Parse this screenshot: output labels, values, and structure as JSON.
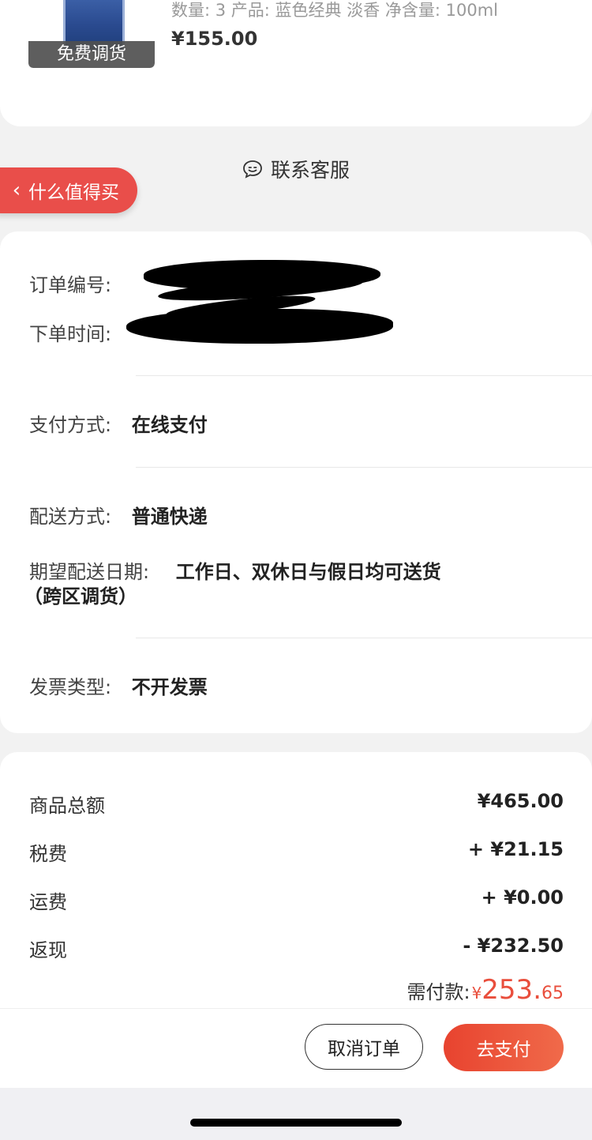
{
  "product": {
    "spec": "数量: 3  产品: 蓝色经典 淡香  净含量: 100ml",
    "price": "¥155.00",
    "badge": "免费调货"
  },
  "contact": {
    "label": "联系客服"
  },
  "floating": {
    "label": "什么值得买"
  },
  "order": {
    "number_label": "订单编号:",
    "time_label": "下单时间:",
    "payment_label": "支付方式:",
    "payment_value": "在线支付",
    "delivery_label": "配送方式:",
    "delivery_value": "普通快递",
    "expected_label": "期望配送日期:",
    "expected_value": "工作日、双休日与假日均可送货",
    "expected_note": "（跨区调货）",
    "invoice_label": "发票类型:",
    "invoice_value": "不开发票"
  },
  "summary": {
    "rows": [
      {
        "label": "商品总额",
        "value": "¥465.00"
      },
      {
        "label": "税费",
        "value": "+ ¥21.15"
      },
      {
        "label": "运费",
        "value": "+ ¥0.00"
      },
      {
        "label": "返现",
        "value": "- ¥232.50"
      }
    ],
    "payable_label": "需付款:",
    "payable_currency": "¥",
    "payable_int": "253.",
    "payable_dec": "65"
  },
  "actions": {
    "cancel": "取消订单",
    "pay": "去支付"
  },
  "colors": {
    "accent": "#e94e3c",
    "pill": "#e94e4a"
  }
}
